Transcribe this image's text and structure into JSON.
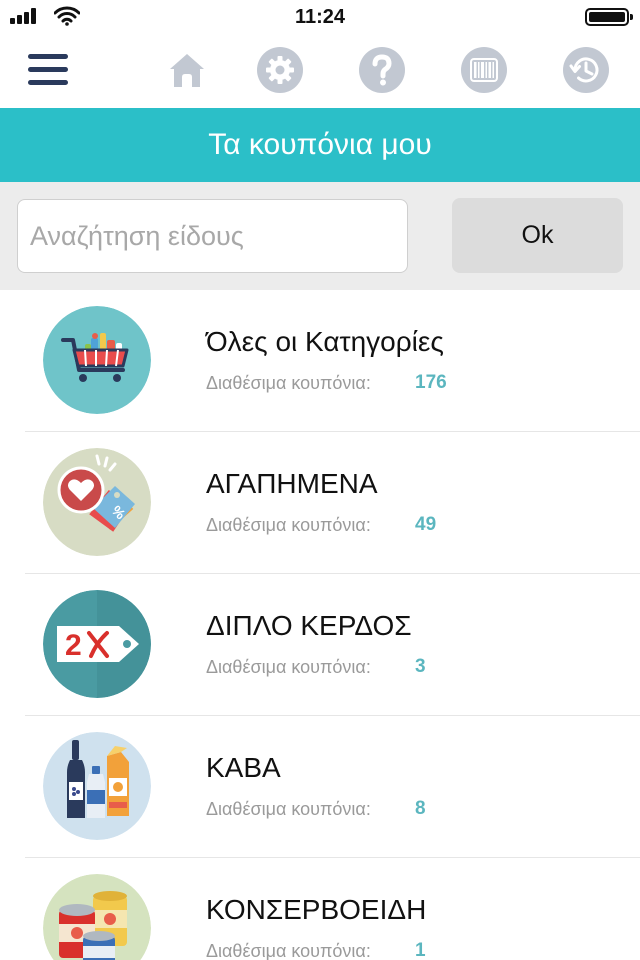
{
  "status": {
    "time": "11:24"
  },
  "nav": {
    "icons": [
      "menu-icon",
      "home-icon",
      "gear-icon",
      "help-icon",
      "barcode-icon",
      "history-icon"
    ]
  },
  "header": {
    "title": "Τα κουπόνια μου"
  },
  "search": {
    "placeholder": "Αναζήτηση είδους",
    "value": "",
    "ok_label": "Ok"
  },
  "categories": [
    {
      "name": "Όλες οι Κατηγορίες",
      "available_label": "Διαθέσιμα κουπόνια:",
      "count": "176",
      "icon": "shopping-cart-icon"
    },
    {
      "name": "ΑΓΑΠΗΜΕΝΑ",
      "available_label": "Διαθέσιμα κουπόνια:",
      "count": "49",
      "icon": "heart-tag-icon"
    },
    {
      "name": "ΔΙΠΛΟ ΚΕΡΔΟΣ",
      "available_label": "Διαθέσιμα κουπόνια:",
      "count": "3",
      "icon": "double-tag-icon"
    },
    {
      "name": "ΚΑΒΑ",
      "available_label": "Διαθέσιμα κουπόνια:",
      "count": "8",
      "icon": "bottles-icon"
    },
    {
      "name": "ΚΟΝΣΕΡΒΟΕΙΔΗ",
      "available_label": "Διαθέσιμα κουπόνια:",
      "count": "1",
      "icon": "cans-icon"
    }
  ],
  "colors": {
    "accent": "#2bbfc8",
    "nav_dark": "#2a3a5c",
    "nav_icon": "#c2c8d2",
    "count": "#5bb6bf"
  }
}
